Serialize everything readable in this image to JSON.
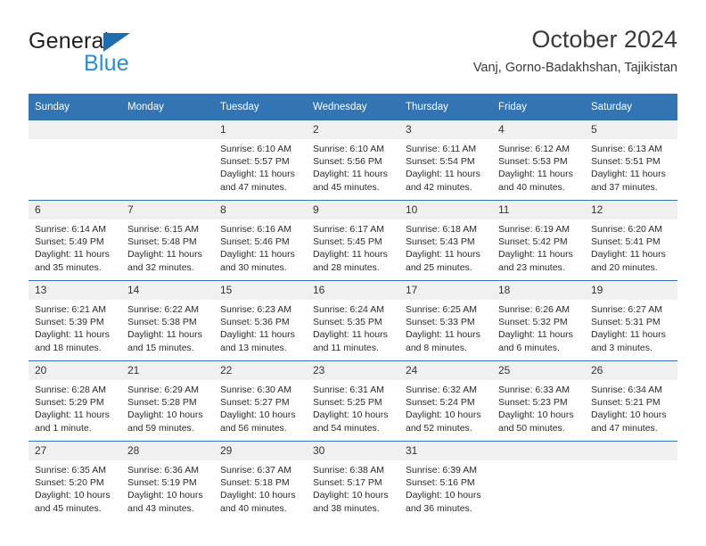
{
  "brand": {
    "name_top": "General",
    "name_bottom": "Blue",
    "accent_dark_blue": "#1f6cb0",
    "accent_light_blue": "#2e8bd4"
  },
  "header": {
    "title": "October 2024",
    "subtitle": "Vanj, Gorno-Badakhshan, Tajikistan"
  },
  "theme": {
    "header_blue": "#3274b4",
    "daynum_gray": "#f0f0f0",
    "text": "#2b2b2b"
  },
  "weekdays": [
    "Sunday",
    "Monday",
    "Tuesday",
    "Wednesday",
    "Thursday",
    "Friday",
    "Saturday"
  ],
  "labels": {
    "sunrise": "Sunrise:",
    "sunset": "Sunset:",
    "daylight": "Daylight:"
  },
  "weeks": [
    [
      {
        "day": "",
        "sunrise": "",
        "sunset": "",
        "daylight_line1": "",
        "daylight_line2": ""
      },
      {
        "day": "",
        "sunrise": "",
        "sunset": "",
        "daylight_line1": "",
        "daylight_line2": ""
      },
      {
        "day": "1",
        "sunrise": "Sunrise: 6:10 AM",
        "sunset": "Sunset: 5:57 PM",
        "daylight_line1": "Daylight: 11 hours",
        "daylight_line2": "and 47 minutes."
      },
      {
        "day": "2",
        "sunrise": "Sunrise: 6:10 AM",
        "sunset": "Sunset: 5:56 PM",
        "daylight_line1": "Daylight: 11 hours",
        "daylight_line2": "and 45 minutes."
      },
      {
        "day": "3",
        "sunrise": "Sunrise: 6:11 AM",
        "sunset": "Sunset: 5:54 PM",
        "daylight_line1": "Daylight: 11 hours",
        "daylight_line2": "and 42 minutes."
      },
      {
        "day": "4",
        "sunrise": "Sunrise: 6:12 AM",
        "sunset": "Sunset: 5:53 PM",
        "daylight_line1": "Daylight: 11 hours",
        "daylight_line2": "and 40 minutes."
      },
      {
        "day": "5",
        "sunrise": "Sunrise: 6:13 AM",
        "sunset": "Sunset: 5:51 PM",
        "daylight_line1": "Daylight: 11 hours",
        "daylight_line2": "and 37 minutes."
      }
    ],
    [
      {
        "day": "6",
        "sunrise": "Sunrise: 6:14 AM",
        "sunset": "Sunset: 5:49 PM",
        "daylight_line1": "Daylight: 11 hours",
        "daylight_line2": "and 35 minutes."
      },
      {
        "day": "7",
        "sunrise": "Sunrise: 6:15 AM",
        "sunset": "Sunset: 5:48 PM",
        "daylight_line1": "Daylight: 11 hours",
        "daylight_line2": "and 32 minutes."
      },
      {
        "day": "8",
        "sunrise": "Sunrise: 6:16 AM",
        "sunset": "Sunset: 5:46 PM",
        "daylight_line1": "Daylight: 11 hours",
        "daylight_line2": "and 30 minutes."
      },
      {
        "day": "9",
        "sunrise": "Sunrise: 6:17 AM",
        "sunset": "Sunset: 5:45 PM",
        "daylight_line1": "Daylight: 11 hours",
        "daylight_line2": "and 28 minutes."
      },
      {
        "day": "10",
        "sunrise": "Sunrise: 6:18 AM",
        "sunset": "Sunset: 5:43 PM",
        "daylight_line1": "Daylight: 11 hours",
        "daylight_line2": "and 25 minutes."
      },
      {
        "day": "11",
        "sunrise": "Sunrise: 6:19 AM",
        "sunset": "Sunset: 5:42 PM",
        "daylight_line1": "Daylight: 11 hours",
        "daylight_line2": "and 23 minutes."
      },
      {
        "day": "12",
        "sunrise": "Sunrise: 6:20 AM",
        "sunset": "Sunset: 5:41 PM",
        "daylight_line1": "Daylight: 11 hours",
        "daylight_line2": "and 20 minutes."
      }
    ],
    [
      {
        "day": "13",
        "sunrise": "Sunrise: 6:21 AM",
        "sunset": "Sunset: 5:39 PM",
        "daylight_line1": "Daylight: 11 hours",
        "daylight_line2": "and 18 minutes."
      },
      {
        "day": "14",
        "sunrise": "Sunrise: 6:22 AM",
        "sunset": "Sunset: 5:38 PM",
        "daylight_line1": "Daylight: 11 hours",
        "daylight_line2": "and 15 minutes."
      },
      {
        "day": "15",
        "sunrise": "Sunrise: 6:23 AM",
        "sunset": "Sunset: 5:36 PM",
        "daylight_line1": "Daylight: 11 hours",
        "daylight_line2": "and 13 minutes."
      },
      {
        "day": "16",
        "sunrise": "Sunrise: 6:24 AM",
        "sunset": "Sunset: 5:35 PM",
        "daylight_line1": "Daylight: 11 hours",
        "daylight_line2": "and 11 minutes."
      },
      {
        "day": "17",
        "sunrise": "Sunrise: 6:25 AM",
        "sunset": "Sunset: 5:33 PM",
        "daylight_line1": "Daylight: 11 hours",
        "daylight_line2": "and 8 minutes."
      },
      {
        "day": "18",
        "sunrise": "Sunrise: 6:26 AM",
        "sunset": "Sunset: 5:32 PM",
        "daylight_line1": "Daylight: 11 hours",
        "daylight_line2": "and 6 minutes."
      },
      {
        "day": "19",
        "sunrise": "Sunrise: 6:27 AM",
        "sunset": "Sunset: 5:31 PM",
        "daylight_line1": "Daylight: 11 hours",
        "daylight_line2": "and 3 minutes."
      }
    ],
    [
      {
        "day": "20",
        "sunrise": "Sunrise: 6:28 AM",
        "sunset": "Sunset: 5:29 PM",
        "daylight_line1": "Daylight: 11 hours",
        "daylight_line2": "and 1 minute."
      },
      {
        "day": "21",
        "sunrise": "Sunrise: 6:29 AM",
        "sunset": "Sunset: 5:28 PM",
        "daylight_line1": "Daylight: 10 hours",
        "daylight_line2": "and 59 minutes."
      },
      {
        "day": "22",
        "sunrise": "Sunrise: 6:30 AM",
        "sunset": "Sunset: 5:27 PM",
        "daylight_line1": "Daylight: 10 hours",
        "daylight_line2": "and 56 minutes."
      },
      {
        "day": "23",
        "sunrise": "Sunrise: 6:31 AM",
        "sunset": "Sunset: 5:25 PM",
        "daylight_line1": "Daylight: 10 hours",
        "daylight_line2": "and 54 minutes."
      },
      {
        "day": "24",
        "sunrise": "Sunrise: 6:32 AM",
        "sunset": "Sunset: 5:24 PM",
        "daylight_line1": "Daylight: 10 hours",
        "daylight_line2": "and 52 minutes."
      },
      {
        "day": "25",
        "sunrise": "Sunrise: 6:33 AM",
        "sunset": "Sunset: 5:23 PM",
        "daylight_line1": "Daylight: 10 hours",
        "daylight_line2": "and 50 minutes."
      },
      {
        "day": "26",
        "sunrise": "Sunrise: 6:34 AM",
        "sunset": "Sunset: 5:21 PM",
        "daylight_line1": "Daylight: 10 hours",
        "daylight_line2": "and 47 minutes."
      }
    ],
    [
      {
        "day": "27",
        "sunrise": "Sunrise: 6:35 AM",
        "sunset": "Sunset: 5:20 PM",
        "daylight_line1": "Daylight: 10 hours",
        "daylight_line2": "and 45 minutes."
      },
      {
        "day": "28",
        "sunrise": "Sunrise: 6:36 AM",
        "sunset": "Sunset: 5:19 PM",
        "daylight_line1": "Daylight: 10 hours",
        "daylight_line2": "and 43 minutes."
      },
      {
        "day": "29",
        "sunrise": "Sunrise: 6:37 AM",
        "sunset": "Sunset: 5:18 PM",
        "daylight_line1": "Daylight: 10 hours",
        "daylight_line2": "and 40 minutes."
      },
      {
        "day": "30",
        "sunrise": "Sunrise: 6:38 AM",
        "sunset": "Sunset: 5:17 PM",
        "daylight_line1": "Daylight: 10 hours",
        "daylight_line2": "and 38 minutes."
      },
      {
        "day": "31",
        "sunrise": "Sunrise: 6:39 AM",
        "sunset": "Sunset: 5:16 PM",
        "daylight_line1": "Daylight: 10 hours",
        "daylight_line2": "and 36 minutes."
      },
      {
        "day": "",
        "sunrise": "",
        "sunset": "",
        "daylight_line1": "",
        "daylight_line2": ""
      },
      {
        "day": "",
        "sunrise": "",
        "sunset": "",
        "daylight_line1": "",
        "daylight_line2": ""
      }
    ]
  ]
}
